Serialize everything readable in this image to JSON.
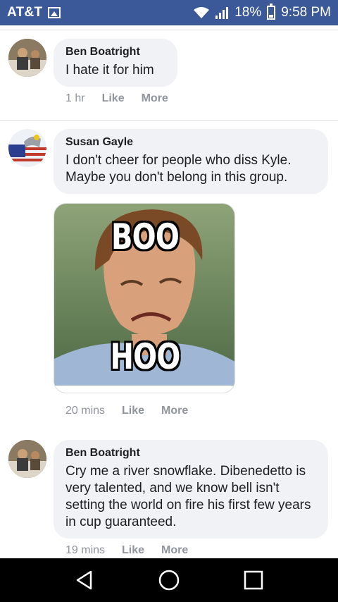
{
  "status_bar": {
    "carrier": "AT&T",
    "battery": "18%",
    "time": "9:58 PM"
  },
  "comments": [
    {
      "author": "Ben Boatright",
      "text": "I hate it for him",
      "time": "1 hr",
      "like_label": "Like",
      "more_label": "More"
    },
    {
      "author": "Susan Gayle",
      "text": "I don't cheer for people who diss Kyle. Maybe you don't belong in this group.",
      "time": "20 mins",
      "like_label": "Like",
      "more_label": "More",
      "attachment": {
        "top_text": "BOO",
        "bottom_text": "HOO"
      }
    },
    {
      "author": "Ben Boatright",
      "text": "Cry me a river snowflake. Dibenedetto is very talented, and we know bell isn't setting the world on fire his first few years in cup guaranteed.",
      "time": "19 mins",
      "like_label": "Like",
      "more_label": "More"
    }
  ],
  "colors": {
    "status_bar": "#3b5998",
    "bubble": "#f0f2f5",
    "meta_text": "#90949c"
  },
  "icons": [
    "image-icon",
    "wifi-icon",
    "signal-icon",
    "battery-icon",
    "back-icon",
    "home-icon",
    "recents-icon"
  ]
}
